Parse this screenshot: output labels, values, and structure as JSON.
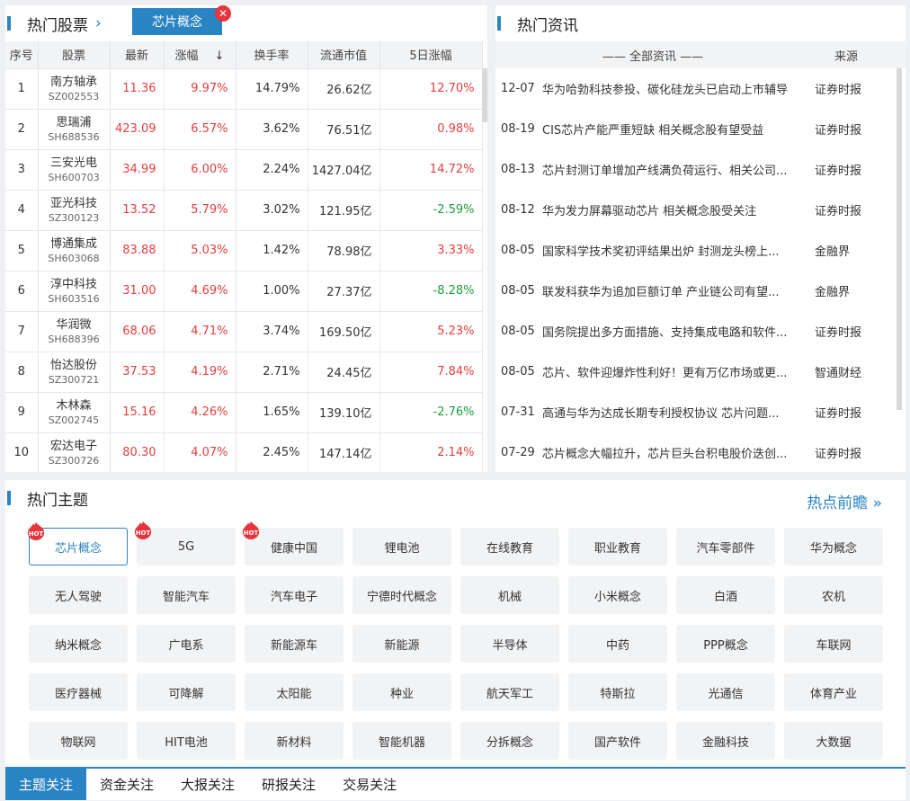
{
  "stocks": {
    "title": "热门股票",
    "active_tag": "芯片概念",
    "headers": [
      "序号",
      "股票",
      "最新",
      "涨幅",
      "换手率",
      "流通市值",
      "5日涨幅"
    ],
    "sort_arrow": "↓",
    "rows": [
      {
        "idx": "1",
        "name": "南方轴承",
        "code": "SZ002553",
        "price": "11.36",
        "change": "9.97%",
        "turnover": "14.79%",
        "cap": "26.62亿",
        "five": "12.70%",
        "five_dir": "up"
      },
      {
        "idx": "2",
        "name": "思瑞浦",
        "code": "SH688536",
        "price": "423.09",
        "change": "6.57%",
        "turnover": "3.62%",
        "cap": "76.51亿",
        "five": "0.98%",
        "five_dir": "up"
      },
      {
        "idx": "3",
        "name": "三安光电",
        "code": "SH600703",
        "price": "34.99",
        "change": "6.00%",
        "turnover": "2.24%",
        "cap": "1427.04亿",
        "five": "14.72%",
        "five_dir": "up"
      },
      {
        "idx": "4",
        "name": "亚光科技",
        "code": "SZ300123",
        "price": "13.52",
        "change": "5.79%",
        "turnover": "3.02%",
        "cap": "121.95亿",
        "five": "-2.59%",
        "five_dir": "down"
      },
      {
        "idx": "5",
        "name": "博通集成",
        "code": "SH603068",
        "price": "83.88",
        "change": "5.03%",
        "turnover": "1.42%",
        "cap": "78.98亿",
        "five": "3.33%",
        "five_dir": "up"
      },
      {
        "idx": "6",
        "name": "淳中科技",
        "code": "SH603516",
        "price": "31.00",
        "change": "4.69%",
        "turnover": "1.00%",
        "cap": "27.37亿",
        "five": "-8.28%",
        "five_dir": "down"
      },
      {
        "idx": "7",
        "name": "华润微",
        "code": "SH688396",
        "price": "68.06",
        "change": "4.71%",
        "turnover": "3.74%",
        "cap": "169.50亿",
        "five": "5.23%",
        "five_dir": "up"
      },
      {
        "idx": "8",
        "name": "怡达股份",
        "code": "SZ300721",
        "price": "37.53",
        "change": "4.19%",
        "turnover": "2.71%",
        "cap": "24.45亿",
        "five": "7.84%",
        "five_dir": "up"
      },
      {
        "idx": "9",
        "name": "木林森",
        "code": "SZ002745",
        "price": "15.16",
        "change": "4.26%",
        "turnover": "1.65%",
        "cap": "139.10亿",
        "five": "-2.76%",
        "five_dir": "down"
      },
      {
        "idx": "10",
        "name": "宏达电子",
        "code": "SZ300726",
        "price": "80.30",
        "change": "4.07%",
        "turnover": "2.45%",
        "cap": "147.14亿",
        "five": "2.14%",
        "five_dir": "up"
      }
    ]
  },
  "news": {
    "title": "热门资讯",
    "col_all": "—— 全部资讯 ——",
    "col_source": "来源",
    "items": [
      {
        "date": "12-07",
        "title": "华为哈勃科技参投、碳化硅龙头已启动上市辅导",
        "source": "证券时报"
      },
      {
        "date": "08-19",
        "title": "CIS芯片产能严重短缺 相关概念股有望受益",
        "source": "证券时报"
      },
      {
        "date": "08-13",
        "title": "芯片封测订单增加产线满负荷运行、相关公司...",
        "source": "证券时报"
      },
      {
        "date": "08-12",
        "title": "华为发力屏幕驱动芯片 相关概念股受关注",
        "source": "证券时报"
      },
      {
        "date": "08-05",
        "title": "国家科学技术奖初评结果出炉 封测龙头榜上...",
        "source": "金融界"
      },
      {
        "date": "08-05",
        "title": "联发科获华为追加巨额订单 产业链公司有望...",
        "source": "金融界"
      },
      {
        "date": "08-05",
        "title": "国务院提出多方面措施、支持集成电路和软件...",
        "source": "证券时报"
      },
      {
        "date": "08-05",
        "title": "芯片、软件迎爆炸性利好！更有万亿市场或更...",
        "source": "智通财经"
      },
      {
        "date": "07-31",
        "title": "高通与华为达成长期专利授权协议 芯片问题...",
        "source": "证券时报"
      },
      {
        "date": "07-29",
        "title": "芯片概念大幅拉升，芯片巨头台积电股价迭创...",
        "source": "证券时报"
      }
    ]
  },
  "topics": {
    "title": "热门主题",
    "more_label": "热点前瞻",
    "hot_label": "HOT",
    "items": [
      "芯片概念",
      "5G",
      "健康中国",
      "锂电池",
      "在线教育",
      "职业教育",
      "汽车零部件",
      "华为概念",
      "无人驾驶",
      "智能汽车",
      "汽车电子",
      "宁德时代概念",
      "机械",
      "小米概念",
      "白酒",
      "农机",
      "纳米概念",
      "广电系",
      "新能源车",
      "新能源",
      "半导体",
      "中药",
      "PPP概念",
      "车联网",
      "医疗器械",
      "可降解",
      "太阳能",
      "种业",
      "航天军工",
      "特斯拉",
      "光通信",
      "体育产业",
      "物联网",
      "HIT电池",
      "新材料",
      "智能机器",
      "分拆概念",
      "国产软件",
      "金融科技",
      "大数据"
    ],
    "hot_count": 3,
    "selected_index": 0
  },
  "tabs": [
    "主题关注",
    "资金关注",
    "大报关注",
    "研报关注",
    "交易关注"
  ],
  "active_tab": 0,
  "colors": {
    "accent": "#2a83c3",
    "up": "#e43e3e",
    "down": "#1b9c3e",
    "hot": "#e8343c"
  }
}
